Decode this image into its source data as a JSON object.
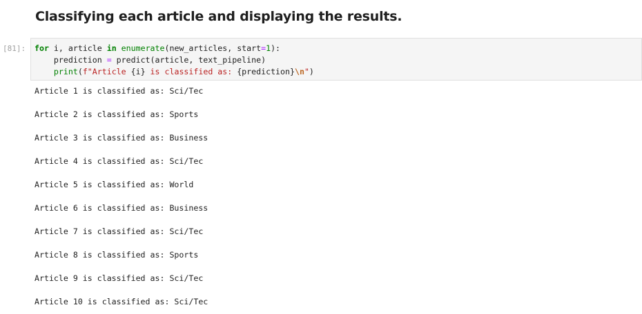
{
  "markdown": {
    "heading": "Classifying each article and displaying the results."
  },
  "code_cell": {
    "prompt": "[81]:",
    "lines": [
      [
        {
          "t": "for",
          "c": "kw"
        },
        {
          "t": " i, article ",
          "c": ""
        },
        {
          "t": "in",
          "c": "kw"
        },
        {
          "t": " ",
          "c": ""
        },
        {
          "t": "enumerate",
          "c": "bi"
        },
        {
          "t": "(new_articles, start",
          "c": ""
        },
        {
          "t": "=",
          "c": "op"
        },
        {
          "t": "1",
          "c": "nm"
        },
        {
          "t": "):",
          "c": ""
        }
      ],
      [
        {
          "t": "    prediction ",
          "c": ""
        },
        {
          "t": "=",
          "c": "op"
        },
        {
          "t": " predict(article, text_pipeline)",
          "c": ""
        }
      ],
      [
        {
          "t": "    ",
          "c": ""
        },
        {
          "t": "print",
          "c": "bi"
        },
        {
          "t": "(",
          "c": ""
        },
        {
          "t": "f\"Article ",
          "c": "str"
        },
        {
          "t": "{i}",
          "c": ""
        },
        {
          "t": " is classified as: ",
          "c": "str"
        },
        {
          "t": "{prediction}",
          "c": ""
        },
        {
          "t": "\\n",
          "c": "esc"
        },
        {
          "t": "\"",
          "c": "str"
        },
        {
          "t": ")",
          "c": ""
        }
      ]
    ]
  },
  "output": [
    "Article 1 is classified as: Sci/Tec",
    "Article 2 is classified as: Sports",
    "Article 3 is classified as: Business",
    "Article 4 is classified as: Sci/Tec",
    "Article 5 is classified as: World",
    "Article 6 is classified as: Business",
    "Article 7 is classified as: Sci/Tec",
    "Article 8 is classified as: Sports",
    "Article 9 is classified as: Sci/Tec",
    "Article 10 is classified as: Sci/Tec"
  ]
}
